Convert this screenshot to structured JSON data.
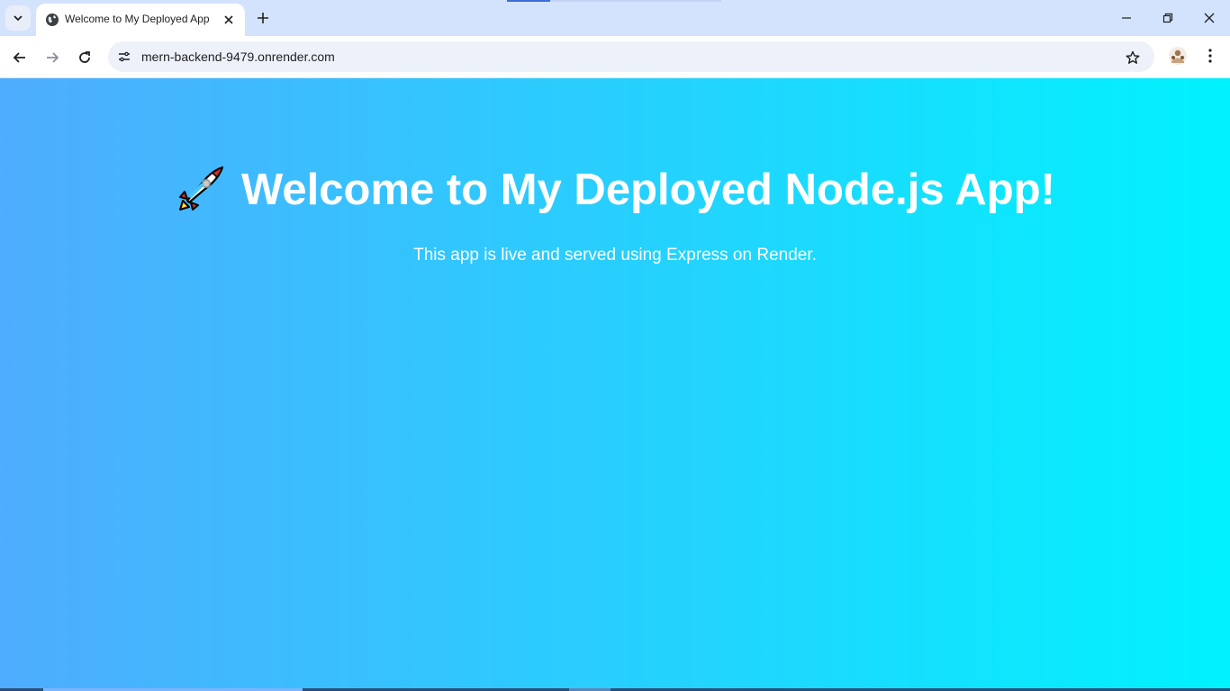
{
  "browser": {
    "tab": {
      "title": "Welcome to My Deployed App"
    },
    "address_bar": {
      "url": "mern-backend-9479.onrender.com"
    },
    "icons": {
      "tab_search": "chevron-down-icon",
      "favicon": "globe-icon",
      "tab_close": "close-icon",
      "new_tab": "plus-icon",
      "minimize": "minimize-icon",
      "restore": "restore-icon",
      "close_window": "close-icon",
      "back": "back-arrow-icon",
      "forward": "forward-arrow-icon",
      "reload": "reload-icon",
      "site_info": "tune-icon",
      "bookmark": "star-icon",
      "extension": "profile-avatar-icon",
      "menu": "kebab-menu-icon"
    }
  },
  "page": {
    "emoji": "rocket-icon",
    "heading": "Welcome to My Deployed Node.js App!",
    "subtitle": "This app is live and served using Express on Render.",
    "colors": {
      "gradient_start": "#4facfe",
      "gradient_end": "#00f2fe",
      "text": "#ffffff"
    }
  }
}
